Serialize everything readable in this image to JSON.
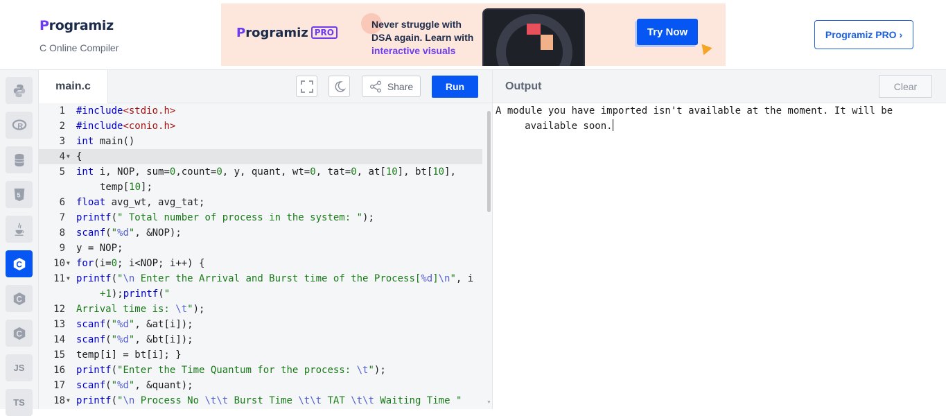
{
  "header": {
    "logo": "Programiz",
    "subtitle": "C Online Compiler",
    "pro_button": "Programiz PRO ›"
  },
  "banner": {
    "logo": "Programiz",
    "badge": "PRO",
    "line1": "Never struggle with",
    "line2": "DSA again. Learn with",
    "line3": "interactive visuals",
    "cta": "Try Now"
  },
  "sidebar": {
    "items": [
      "python-icon",
      "r-icon",
      "sql-icon",
      "html-icon",
      "java-icon",
      "c-icon",
      "cpp-icon",
      "csharp-icon",
      "JS",
      "TS"
    ],
    "active": "c-icon"
  },
  "editor": {
    "filename": "main.c",
    "share_label": "Share",
    "run_label": "Run",
    "lines": [
      {
        "n": "1",
        "t": "#include<stdio.h>"
      },
      {
        "n": "2",
        "t": "#include<conio.h>"
      },
      {
        "n": "3",
        "t": "int main()"
      },
      {
        "n": "4",
        "t": "{"
      },
      {
        "n": "5",
        "t": "int i, NOP, sum=0,count=0, y, quant, wt=0, tat=0, at[10], bt[10],",
        "c": "temp[10];"
      },
      {
        "n": "6",
        "t": "float avg_wt, avg_tat;"
      },
      {
        "n": "7",
        "t": "printf(\" Total number of process in the system: \");"
      },
      {
        "n": "8",
        "t": "scanf(\"%d\", &NOP);"
      },
      {
        "n": "9",
        "t": "y = NOP;"
      },
      {
        "n": "10",
        "t": "for(i=0; i<NOP; i++) {"
      },
      {
        "n": "11",
        "t": "printf(\"\\n Enter the Arrival and Burst time of the Process[%d]\\n\", i",
        "c": "+1);printf(\""
      },
      {
        "n": "12",
        "t": "Arrival time is: \\t\");"
      },
      {
        "n": "13",
        "t": "scanf(\"%d\", &at[i]);"
      },
      {
        "n": "14",
        "t": "scanf(\"%d\", &bt[i]);"
      },
      {
        "n": "15",
        "t": "temp[i] = bt[i]; }"
      },
      {
        "n": "16",
        "t": "printf(\"Enter the Time Quantum for the process: \\t\");"
      },
      {
        "n": "17",
        "t": "scanf(\"%d\", &quant);"
      },
      {
        "n": "18",
        "t": "printf(\"\\n Process No \\t\\t Burst Time \\t\\t TAT \\t\\t Waiting Time \""
      }
    ]
  },
  "output": {
    "title": "Output",
    "clear_label": "Clear",
    "line1": "A module you have imported isn't available at the moment. It will be",
    "line2": "     available soon."
  }
}
